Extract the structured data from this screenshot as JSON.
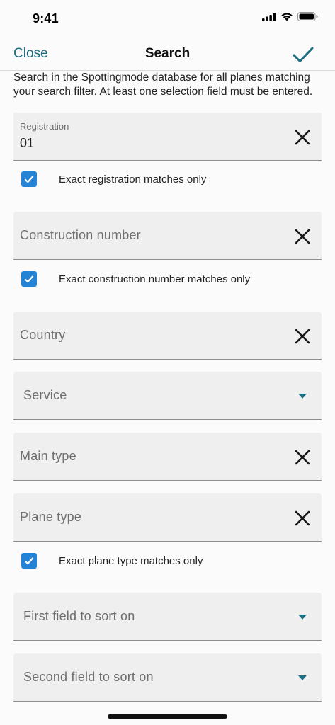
{
  "status_bar": {
    "time": "9:41",
    "icons": [
      "signal-icon",
      "wifi-icon",
      "battery-icon"
    ]
  },
  "nav": {
    "close_label": "Close",
    "title": "Search",
    "done_icon": "checkmark-icon"
  },
  "intro_text": "Search in the Spottingmode database for all planes matching your search filter. At least one selection field must be entered.",
  "fields": {
    "registration": {
      "label": "Registration",
      "value": "01"
    },
    "construction_number": {
      "placeholder": "Construction number"
    },
    "country": {
      "placeholder": "Country"
    },
    "service": {
      "placeholder": "Service"
    },
    "main_type": {
      "placeholder": "Main type"
    },
    "plane_type": {
      "placeholder": "Plane type"
    },
    "sort_first": {
      "placeholder": "First field to sort on"
    },
    "sort_second": {
      "placeholder": "Second field to sort on"
    }
  },
  "checkboxes": {
    "exact_registration": {
      "label": "Exact registration matches only",
      "checked": true
    },
    "exact_construction": {
      "label": "Exact construction number matches only",
      "checked": true
    },
    "exact_plane_type": {
      "label": "Exact plane type matches only",
      "checked": true
    }
  },
  "colors": {
    "accent": "#1e6e82",
    "checkbox": "#2583d6",
    "field_bg": "#efeff0"
  }
}
